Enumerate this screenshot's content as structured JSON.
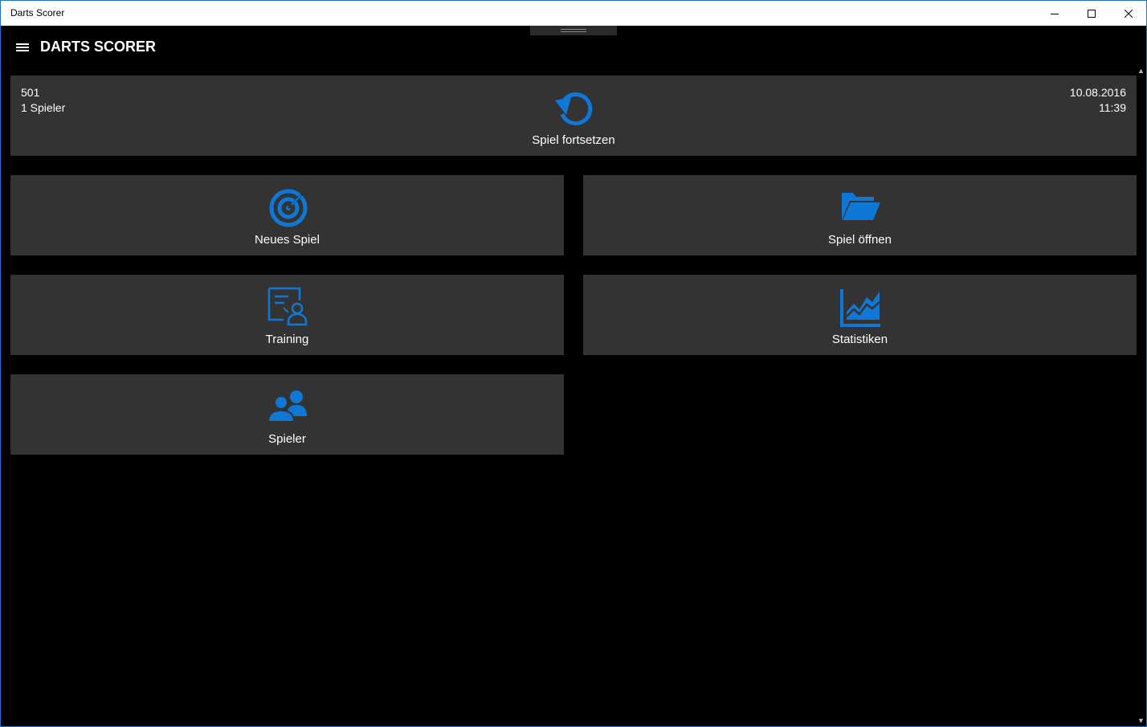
{
  "window": {
    "title": "Darts Scorer"
  },
  "header": {
    "app_title": "DARTS SCORER"
  },
  "resume_tile": {
    "game": "501",
    "players": "1 Spieler",
    "date": "10.08.2016",
    "time": "11:39",
    "label": "Spiel fortsetzen",
    "icon": "refresh-icon"
  },
  "tiles": [
    {
      "label": "Neues Spiel",
      "icon": "target-icon"
    },
    {
      "label": "Spiel öffnen",
      "icon": "folder-open-icon"
    },
    {
      "label": "Training",
      "icon": "training-icon"
    },
    {
      "label": "Statistiken",
      "icon": "chart-icon"
    },
    {
      "label": "Spieler",
      "icon": "players-icon"
    }
  ],
  "colors": {
    "accent": "#0f78d7",
    "tile_bg": "#333333",
    "app_bg": "#000000"
  }
}
